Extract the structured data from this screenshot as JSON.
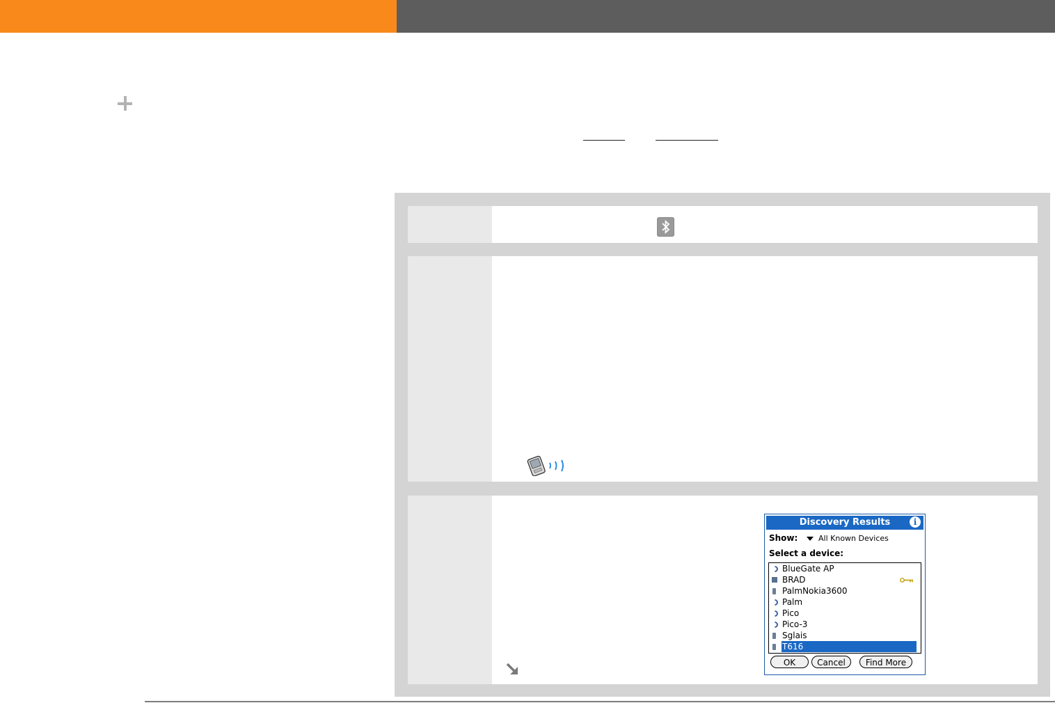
{
  "discovery_results": {
    "title": "Discovery Results",
    "info_label": "i",
    "show_label": "Show:",
    "show_value": "All Known Devices",
    "select_label": "Select a device:",
    "devices": [
      {
        "name": "BlueGate AP",
        "icon": "bluetooth-access-point-icon"
      },
      {
        "name": "BRAD",
        "icon": "computer-icon",
        "trusted": true
      },
      {
        "name": "PalmNokia3600",
        "icon": "phone-icon"
      },
      {
        "name": "Palm",
        "icon": "bluetooth-access-point-icon"
      },
      {
        "name": "Pico",
        "icon": "bluetooth-access-point-icon"
      },
      {
        "name": "Pico-3",
        "icon": "bluetooth-access-point-icon"
      },
      {
        "name": "Sglais",
        "icon": "phone-icon"
      },
      {
        "name": "T616",
        "icon": "phone-icon",
        "selected": true
      }
    ],
    "buttons": {
      "ok": "OK",
      "cancel": "Cancel",
      "find_more": "Find More"
    }
  },
  "colors": {
    "header_accent": "#f8891a",
    "header_dark": "#5d5d5d",
    "panel": "#d4d4d4",
    "step_number_bg": "#e9e9e9",
    "palm_title_blue": "#1a68c4"
  },
  "icons": [
    "plus-icon",
    "bluetooth-icon",
    "beam-icon",
    "continue-arrow-icon",
    "key-icon"
  ]
}
